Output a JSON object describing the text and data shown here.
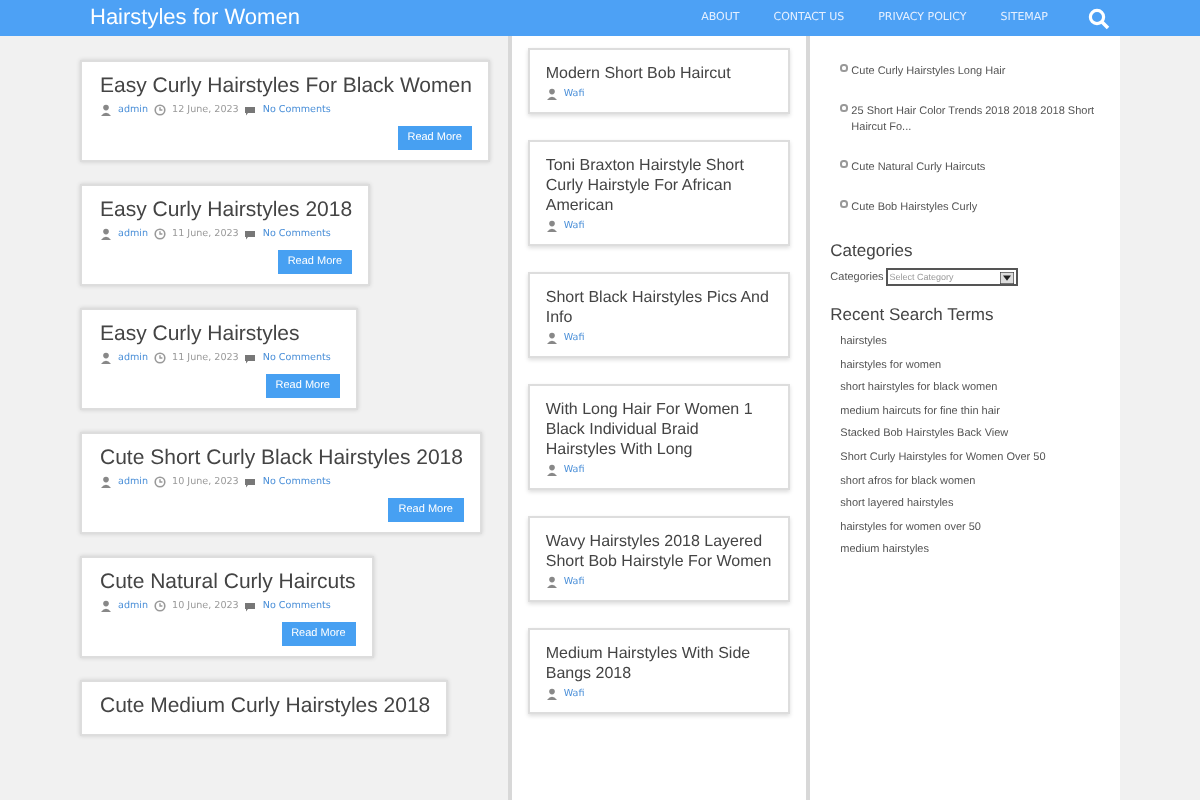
{
  "header": {
    "site_title": "Hairstyles for Women",
    "nav": [
      {
        "label": "ABOUT"
      },
      {
        "label": "CONTACT US"
      },
      {
        "label": "PRIVACY POLICY"
      },
      {
        "label": "SITEMAP"
      }
    ]
  },
  "posts": [
    {
      "title": "Easy Curly Hairstyles For Black Women",
      "author": "admin",
      "date": "12 June, 2023",
      "comments": "No Comments",
      "button": "Read More"
    },
    {
      "title": "Easy Curly Hairstyles 2018",
      "author": "admin",
      "date": "11 June, 2023",
      "comments": "No Comments",
      "button": "Read More"
    },
    {
      "title": "Easy Curly Hairstyles",
      "author": "admin",
      "date": "11 June, 2023",
      "comments": "No Comments",
      "button": "Read More"
    },
    {
      "title": "Cute Short Curly Black Hairstyles 2018",
      "author": "admin",
      "date": "10 June, 2023",
      "comments": "No Comments",
      "button": "Read More"
    },
    {
      "title": "Cute Natural Curly Haircuts",
      "author": "admin",
      "date": "10 June, 2023",
      "comments": "No Comments",
      "button": "Read More"
    },
    {
      "title": "Cute Medium Curly Hairstyles 2018"
    }
  ],
  "middle_posts": [
    {
      "title": "Modern Short Bob Haircut",
      "author": "Wafi"
    },
    {
      "title": "Toni Braxton Hairstyle Short Curly Hairstyle For African American",
      "author": "Wafi"
    },
    {
      "title": "Short Black Hairstyles Pics And Info",
      "author": "Wafi"
    },
    {
      "title": "With Long Hair For Women 1 Black Individual Braid Hairstyles With Long",
      "author": "Wafi"
    },
    {
      "title": "Wavy Hairstyles 2018 Layered Short Bob Hairstyle For Women",
      "author": "Wafi"
    },
    {
      "title": "Medium Hairstyles With Side Bangs 2018",
      "author": "Wafi"
    }
  ],
  "sidebar": {
    "recent_posts": [
      "Cute Curly Hairstyles Long Hair",
      "25 Short Hair Color Trends 2018 2018 2018 Short Haircut Fo...",
      "Cute Natural Curly Haircuts",
      "Cute Bob Hairstyles Curly"
    ],
    "categories": {
      "heading": "Categories",
      "label": "Categories",
      "placeholder": "Select Category"
    },
    "search_terms": {
      "heading": "Recent Search Terms",
      "items": [
        "hairstyles",
        "hairstyles for women",
        "short hairstyles for black women",
        "medium haircuts for fine thin hair",
        "Stacked Bob Hairstyles Back View",
        "Short Curly Hairstyles for Women Over 50",
        "short afros for black women",
        "short layered hairstyles",
        "hairstyles for women over 50",
        "medium hairstyles"
      ]
    }
  }
}
